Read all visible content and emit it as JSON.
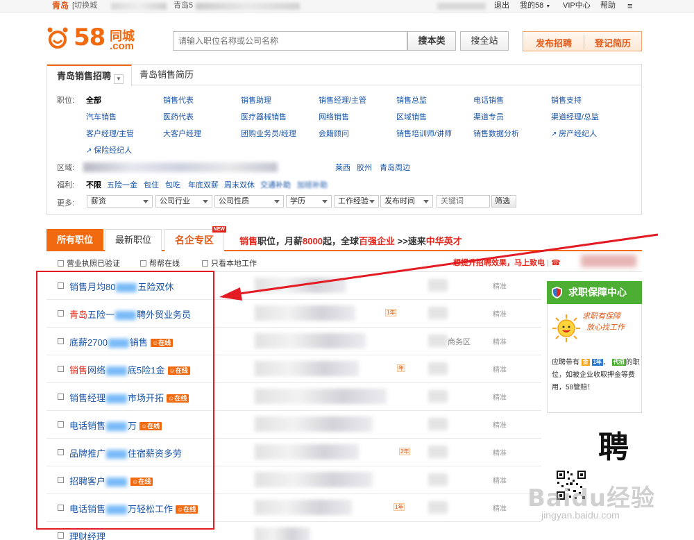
{
  "topbar": {
    "city": "青岛",
    "switch_label": "[切换城",
    "city2": "青岛5",
    "logout": "退出",
    "my58": "我的58",
    "vip": "VIP中心",
    "help": "帮助",
    "menu_icon": "≡"
  },
  "header": {
    "logo_58": "58",
    "logo_city": "同城",
    "logo_com": ".com",
    "search_placeholder": "请输入职位名称或公司名称",
    "search_category": "搜本类",
    "search_site": "搜全站",
    "publish_job": "发布招聘",
    "post_resume": "登记简历"
  },
  "filter": {
    "tab_jobs": "青岛销售招聘",
    "tab_resume": "青岛销售简历",
    "position_label": "职位:",
    "positions": [
      [
        "全部",
        "销售代表",
        "销售助理",
        "销售经理/主管",
        "销售总监",
        "电话销售",
        "销售支持"
      ],
      [
        "汽车销售",
        "医药代表",
        "医疗器械销售",
        "网络销售",
        "区域销售",
        "渠道专员",
        "渠道经理/总监"
      ],
      [
        "客户经理/主管",
        "大客户经理",
        "团购业务员/经理",
        "会籍顾问",
        "销售培训师/讲师",
        "销售数据分析",
        "房产经纪人"
      ],
      [
        "保险经纪人"
      ]
    ],
    "area_label": "区域:",
    "areas": [
      "莱西",
      "胶州",
      "青岛周边"
    ],
    "welfare_label": "福利:",
    "welfare": [
      "不限",
      "五险一金",
      "包住",
      "包吃",
      "年底双薪",
      "周末双休",
      "交通补助",
      "加班补助"
    ],
    "more_label": "更多:",
    "selects": [
      "薪资",
      "公司行业",
      "公司性质",
      "学历",
      "工作经验",
      "发布时间"
    ],
    "keyword_placeholder": "关键词",
    "filter_button": "筛选"
  },
  "listing": {
    "tabs": [
      "所有职位",
      "最新职位",
      "名企专区"
    ],
    "new_badge": "NEW",
    "promo": {
      "p1": "销售",
      "p2": "职位，月薪",
      "p3": "8000",
      "p4": "起，全球",
      "p5": "百强企业",
      "p6": " >>速来",
      "p7": "中华英才"
    },
    "options": [
      "营业执照已验证",
      "帮帮在线",
      "只看本地工作"
    ],
    "hint": "想提升招聘效果，马上致电",
    "online_label": "在线",
    "rows": [
      {
        "a": "销售月均80",
        "b": "五险双休",
        "red": "",
        "online": false,
        "date": "精准",
        "loctext": ""
      },
      {
        "a": "五险一",
        "b": "聘外贸业务员",
        "red": "青岛",
        "online": false,
        "date": "精准",
        "loctext": "",
        "year": "1年"
      },
      {
        "a": "底薪2700",
        "b": "销售",
        "red": "",
        "online": true,
        "date": "精准",
        "loctext": "商务区"
      },
      {
        "a": "网络",
        "b": "底5险1金",
        "red": "销售",
        "online": true,
        "date": "精准",
        "loctext": "",
        "year": "年"
      },
      {
        "a": "销售经理",
        "b": "市场开拓",
        "red": "",
        "online": true,
        "date": "精准",
        "loctext": ""
      },
      {
        "a": "电话销售",
        "b": "万",
        "red": "",
        "online": true,
        "date": "精准",
        "loctext": ""
      },
      {
        "a": "品牌推广",
        "b": "住宿薪资多劳",
        "red": "",
        "online": false,
        "date": "精准",
        "loctext": "",
        "year": "2年"
      },
      {
        "a": "招聘客户",
        "b": "",
        "red": "",
        "online": true,
        "date": "精准",
        "loctext": ""
      },
      {
        "a": "电话销售",
        "b": "万轻松工作",
        "red": "",
        "online": true,
        "date": "精准",
        "loctext": "",
        "year": "1年"
      },
      {
        "a": "理财经理",
        "b": "",
        "red": "",
        "online": false,
        "date": "",
        "loctext": ""
      }
    ]
  },
  "sidebar": {
    "title": "求职保障中心",
    "slogan1": "求职有保障",
    "slogan2": "放心找工作",
    "text1": "应聘带有",
    "badge_gold": "金",
    "badge_year": "1年",
    "text2": "、",
    "badge_daizhao": "代招",
    "text3": "的职位，如被企业收取押金等费用，58管赔！",
    "big_char": "聘",
    "watermark": "Baidu经验",
    "watermark2": "jingyan.baidu.com"
  },
  "colors": {
    "brand_orange": "#f26a10",
    "link_blue": "#1a55a8",
    "alert_red": "#e3261b",
    "guarantee_green": "#4caf34"
  }
}
